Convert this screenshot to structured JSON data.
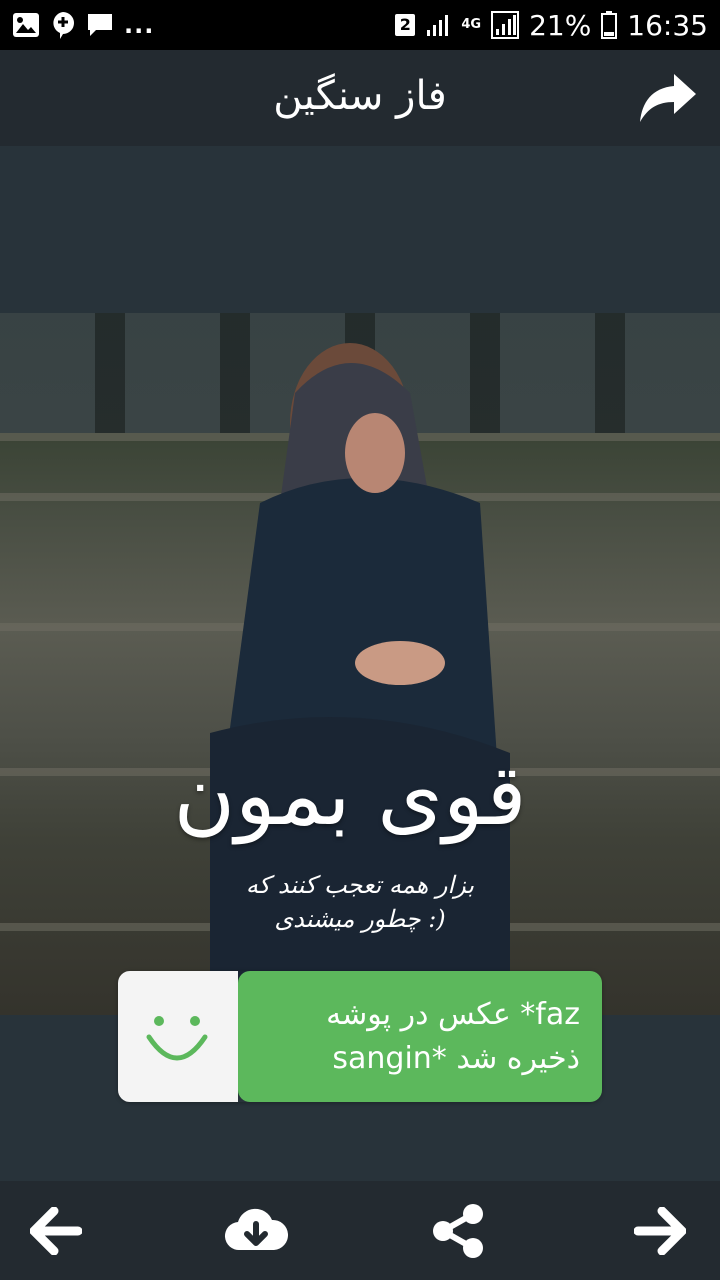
{
  "status_bar": {
    "sim_badge": "2",
    "network": "4G",
    "battery": "21%",
    "time": "16:35",
    "more": "..."
  },
  "appbar": {
    "title": "فاز سنگین",
    "share_icon": "share-forward-icon"
  },
  "image": {
    "caption_main": "قوی بمون",
    "caption_line1": "بزار همه تعجب کنند که",
    "caption_line2": "چطور میشندی :)"
  },
  "toast": {
    "line1": "عکس در پوشه *faz",
    "line2": "sangin* ذخیره شد",
    "icon": "smiley-icon"
  },
  "bottom_nav": {
    "prev_icon": "arrow-left-icon",
    "download_icon": "cloud-download-icon",
    "share_icon": "share-icon",
    "next_icon": "arrow-right-icon"
  },
  "colors": {
    "toast_green": "#5cb85c",
    "bar": "#232a30"
  }
}
